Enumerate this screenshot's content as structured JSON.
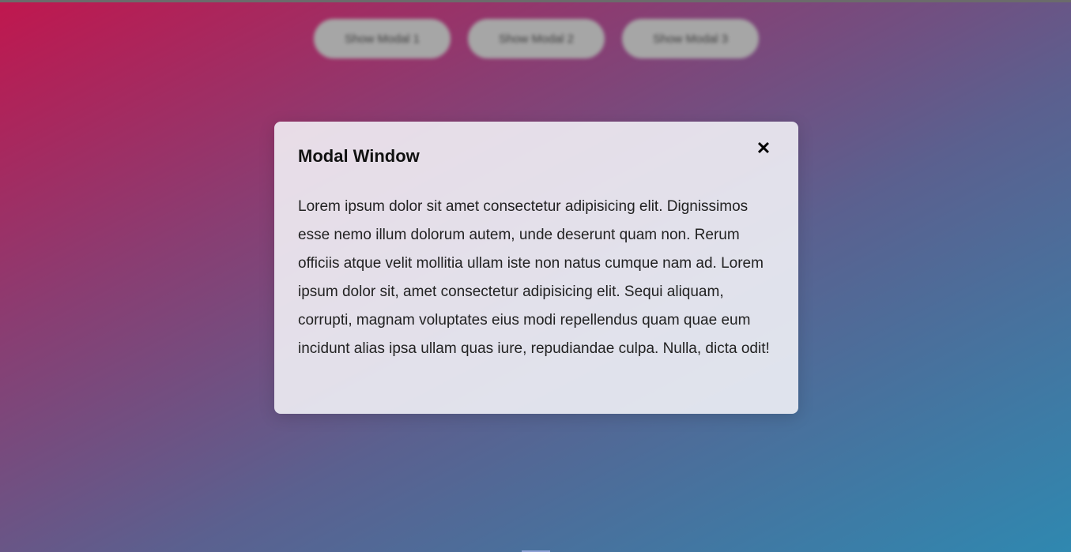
{
  "background": {
    "gradient_start": "#c0174e",
    "gradient_mid": "#5b608f",
    "gradient_end": "#2f88b0"
  },
  "buttons": [
    {
      "label": "Show Modal 1"
    },
    {
      "label": "Show Modal 2"
    },
    {
      "label": "Show Modal 3"
    }
  ],
  "modal": {
    "title": "Modal Window",
    "close_icon": "close-icon",
    "close_glyph": "✕",
    "body": "Lorem ipsum dolor sit amet consectetur adipisicing elit. Dignissimos esse nemo illum dolorum autem, unde deserunt quam non. Rerum officiis atque velit mollitia ullam iste non natus cumque nam ad. Lorem ipsum dolor sit, amet consectetur adipisicing elit. Sequi aliquam, corrupti, magnam voluptates eius modi repellendus quam quae eum incidunt alias ipsa ullam quas iure, repudiandae culpa. Nulla, dicta odit!"
  }
}
